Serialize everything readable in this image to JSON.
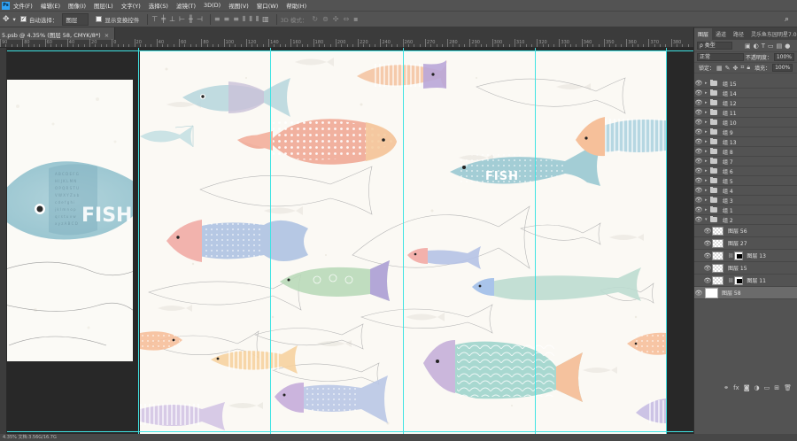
{
  "menu": [
    "文件(F)",
    "编辑(E)",
    "图像(I)",
    "图层(L)",
    "文字(Y)",
    "选择(S)",
    "滤镜(T)",
    "3D(D)",
    "视图(V)",
    "窗口(W)",
    "帮助(H)"
  ],
  "app_logo": "Ps",
  "options": {
    "auto_select_label": "自动选择：",
    "auto_select_value": "图层",
    "show_transform_label": "显示变换控件",
    "mode_3d_label": "3D 模式："
  },
  "document_tab": {
    "title": "5.psb @ 4.35% (图层 58, CMYK/8*)",
    "close": "×"
  },
  "ruler_labels": [
    "90",
    "80",
    "60",
    "40",
    "20",
    "0",
    "20",
    "40",
    "60",
    "80",
    "100",
    "120",
    "140",
    "160",
    "180",
    "200",
    "220",
    "240",
    "260",
    "270",
    "280",
    "290",
    "300",
    "310",
    "320",
    "330",
    "340",
    "350",
    "360",
    "370",
    "380"
  ],
  "canvas_text": {
    "fish_word": "FISH"
  },
  "panel": {
    "tabs": [
      "图层",
      "通道",
      "路径",
      "灵乐鱼东园明星7.0"
    ],
    "filter_kind": "ρ 类型",
    "blend_mode": "正常",
    "opacity_label": "不透明度：",
    "opacity_value": "100%",
    "lock_label": "锁定：",
    "fill_label": "填充：",
    "fill_value": "100%"
  },
  "layers": [
    {
      "name": "组 15",
      "kind": "group"
    },
    {
      "name": "组 14",
      "kind": "group"
    },
    {
      "name": "组 12",
      "kind": "group"
    },
    {
      "name": "组 11",
      "kind": "group"
    },
    {
      "name": "组 10",
      "kind": "group"
    },
    {
      "name": "组 9",
      "kind": "group"
    },
    {
      "name": "组 13",
      "kind": "group"
    },
    {
      "name": "组 8",
      "kind": "group"
    },
    {
      "name": "组 7",
      "kind": "group"
    },
    {
      "name": "组 6",
      "kind": "group"
    },
    {
      "name": "组 5",
      "kind": "group"
    },
    {
      "name": "组 4",
      "kind": "group"
    },
    {
      "name": "组 3",
      "kind": "group"
    },
    {
      "name": "组 1",
      "kind": "group"
    },
    {
      "name": "组 2",
      "kind": "group-open"
    },
    {
      "name": "图层 56",
      "kind": "layer"
    },
    {
      "name": "图层 27",
      "kind": "layer"
    },
    {
      "name": "图层 13",
      "kind": "masked"
    },
    {
      "name": "图层 15",
      "kind": "layer"
    },
    {
      "name": "图层 11",
      "kind": "masked"
    },
    {
      "name": "图层 58",
      "kind": "background"
    }
  ],
  "footer_icons": [
    "link-icon",
    "fx-icon",
    "mask-icon",
    "adjustment-icon",
    "folder-icon",
    "new-layer-icon",
    "trash-icon"
  ],
  "status_text": "4.35%    文档:3.56G/16.7G",
  "colors": {
    "guide": "#3fe3e3",
    "panel_bg": "#535353",
    "canvas_bg": "#282828"
  }
}
